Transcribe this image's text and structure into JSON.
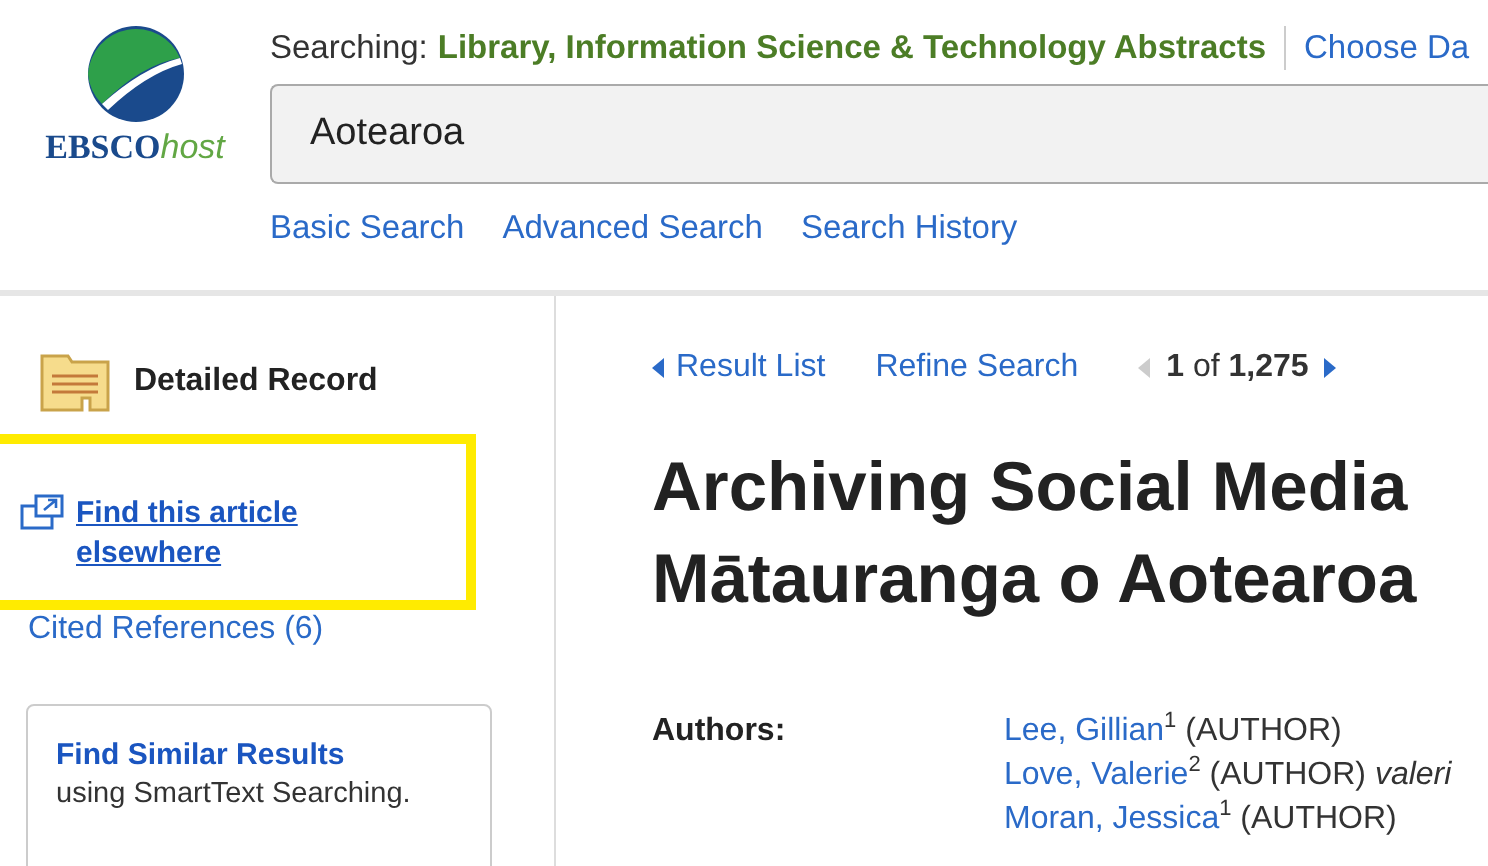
{
  "header": {
    "logo": {
      "text_bold": "EBSCO",
      "text_italic": "host"
    },
    "searching_label": "Searching:",
    "database": "Library, Information Science & Technology Abstracts",
    "choose_link": "Choose Da",
    "search_value": "Aotearoa",
    "links": [
      "Basic Search",
      "Advanced Search",
      "Search History"
    ]
  },
  "sidebar": {
    "section_title": "Detailed Record",
    "find_link": "Find this article elsewhere",
    "highlighted": true,
    "cited_link": "Cited References (6)",
    "similar_card": {
      "title": "Find Similar Results",
      "subtitle": "using SmartText Searching."
    }
  },
  "record": {
    "nav": {
      "back": "Result List",
      "refine": "Refine Search",
      "position": "**1** of **1,275**"
    },
    "title_lines": [
      "Archiving Social Media",
      "Mātauranga o Aotearoa"
    ],
    "authors_label": "Authors:",
    "authors": [
      {
        "name": "Lee, Gillian",
        "detail": "$^{1}$ (AUTHOR)"
      },
      {
        "name": "Love, Valerie",
        "detail": "$^{2}$ (AUTHOR) *valeri*"
      },
      {
        "name": "Moran, Jessica",
        "detail": "$^{1}$ (AUTHOR)"
      }
    ]
  }
}
